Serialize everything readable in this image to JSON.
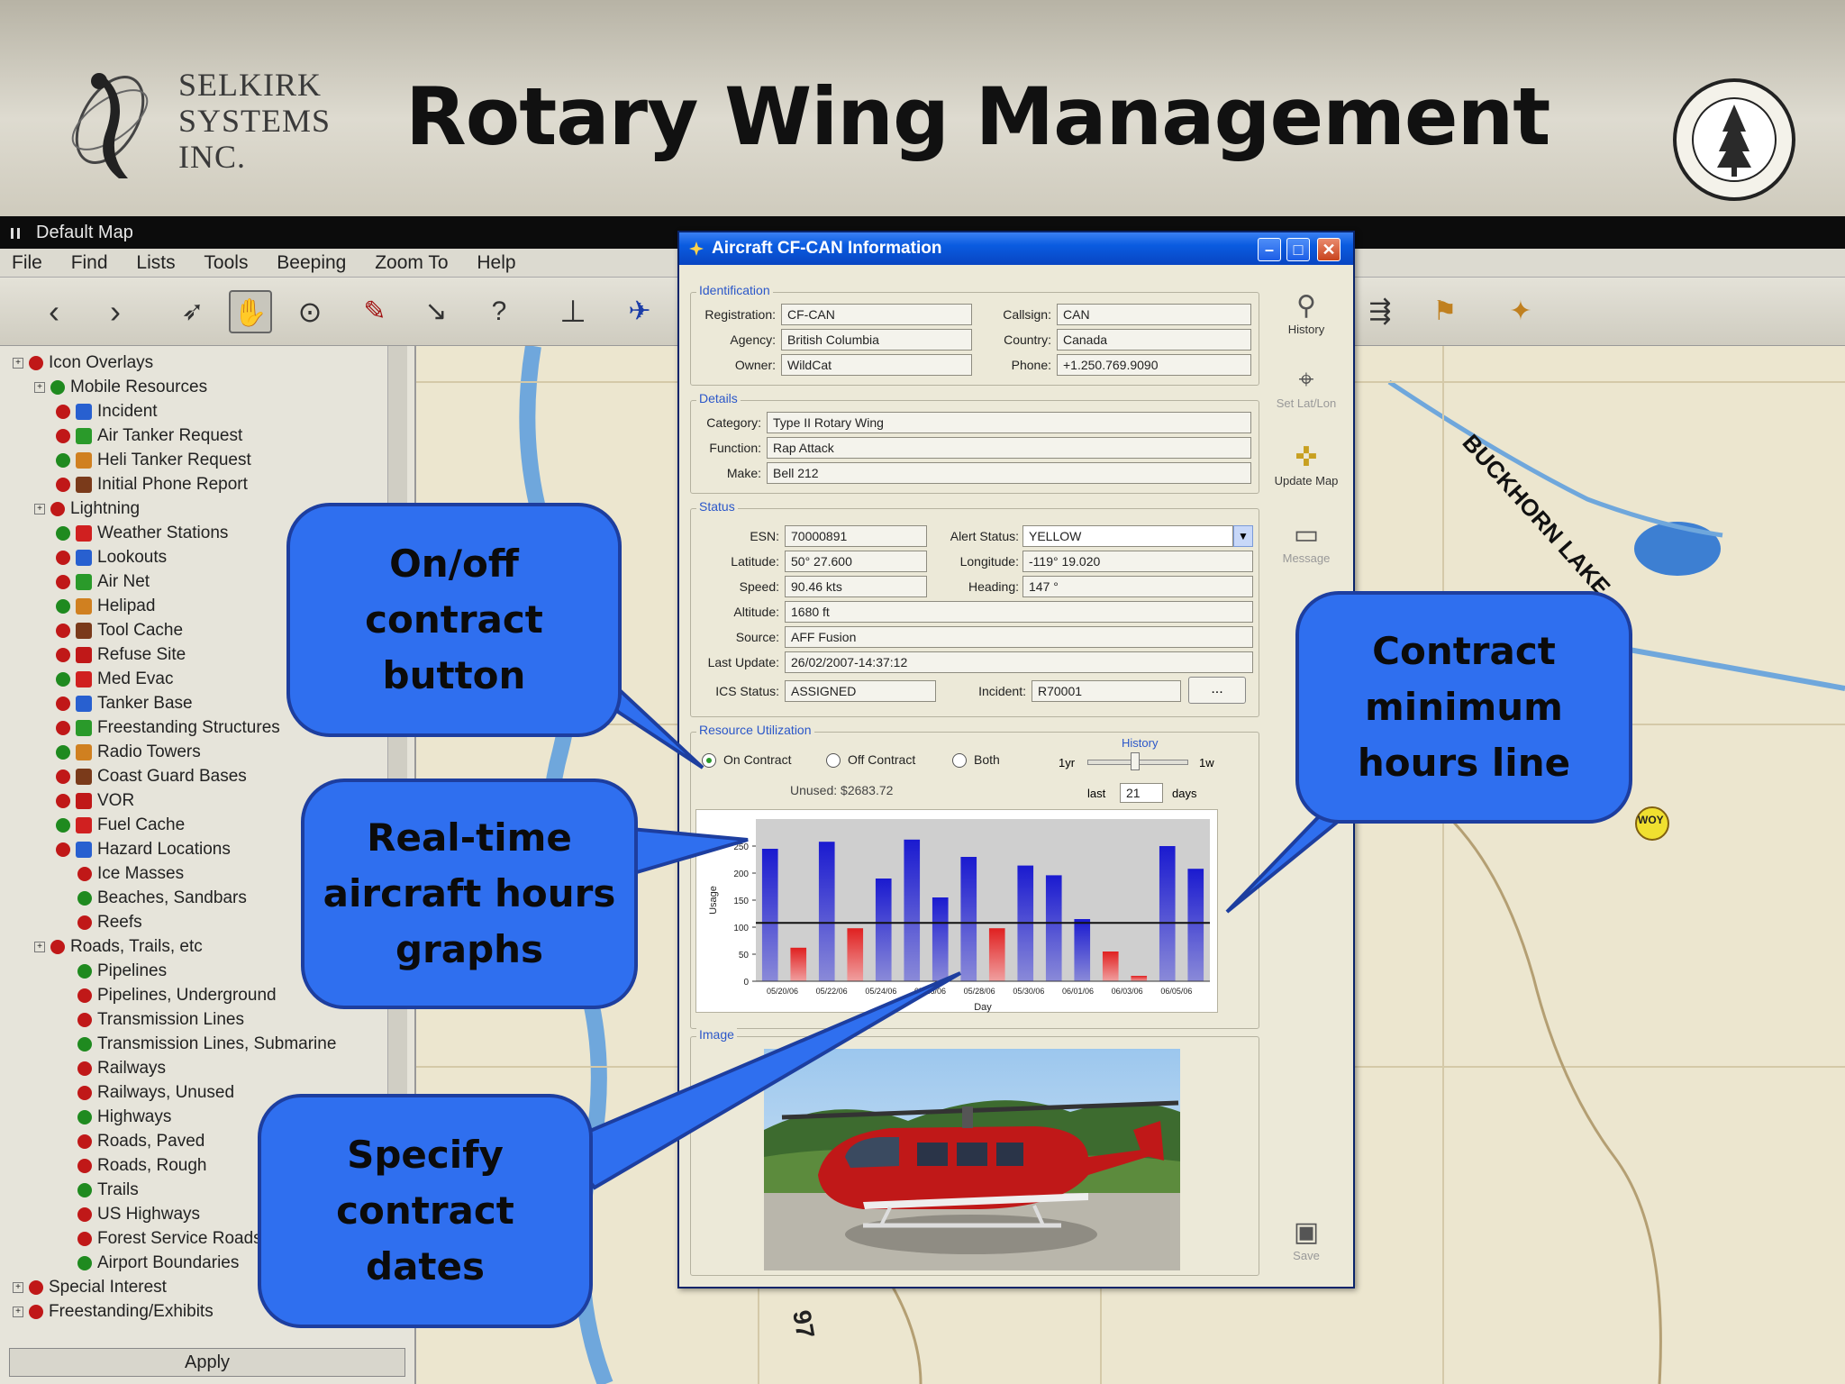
{
  "header": {
    "company_lines": [
      "SELKIRK",
      "SYSTEMS",
      "INC."
    ],
    "title": "Rotary Wing Management"
  },
  "app": {
    "window_title": "Default Map",
    "menu": [
      "File",
      "Find",
      "Lists",
      "Tools",
      "Beeping",
      "Zoom To",
      "Help"
    ]
  },
  "tree": {
    "items": [
      {
        "label": "Icon Overlays",
        "indent": 0
      },
      {
        "label": "Mobile Resources",
        "indent": 1
      },
      {
        "label": "Incident",
        "indent": 2
      },
      {
        "label": "Air Tanker Request",
        "indent": 2
      },
      {
        "label": "Heli Tanker Request",
        "indent": 2
      },
      {
        "label": "Initial Phone Report",
        "indent": 2
      },
      {
        "label": "Lightning",
        "indent": 1
      },
      {
        "label": "Weather Stations",
        "indent": 2
      },
      {
        "label": "Lookouts",
        "indent": 2
      },
      {
        "label": "Air Net",
        "indent": 2
      },
      {
        "label": "Helipad",
        "indent": 2
      },
      {
        "label": "Tool Cache",
        "indent": 2
      },
      {
        "label": "Refuse Site",
        "indent": 2
      },
      {
        "label": "Med Evac",
        "indent": 2
      },
      {
        "label": "Tanker Base",
        "indent": 2
      },
      {
        "label": "Freestanding Structures",
        "indent": 2
      },
      {
        "label": "Radio Towers",
        "indent": 2
      },
      {
        "label": "Coast Guard Bases",
        "indent": 2
      },
      {
        "label": "VOR",
        "indent": 2
      },
      {
        "label": "Fuel Cache",
        "indent": 2
      },
      {
        "label": "Hazard Locations",
        "indent": 2
      },
      {
        "label": "Ice Masses",
        "indent": 3
      },
      {
        "label": "Beaches, Sandbars",
        "indent": 3
      },
      {
        "label": "Reefs",
        "indent": 3
      },
      {
        "label": "Roads, Trails, etc",
        "indent": 1
      },
      {
        "label": "Pipelines",
        "indent": 3
      },
      {
        "label": "Pipelines, Underground",
        "indent": 3
      },
      {
        "label": "Transmission Lines",
        "indent": 3
      },
      {
        "label": "Transmission Lines, Submarine",
        "indent": 3
      },
      {
        "label": "Railways",
        "indent": 3
      },
      {
        "label": "Railways, Unused",
        "indent": 3
      },
      {
        "label": "Highways",
        "indent": 3
      },
      {
        "label": "Roads, Paved",
        "indent": 3
      },
      {
        "label": "Roads, Rough",
        "indent": 3
      },
      {
        "label": "Trails",
        "indent": 3
      },
      {
        "label": "US Highways",
        "indent": 3
      },
      {
        "label": "Forest Service Roads",
        "indent": 3
      },
      {
        "label": "Airport Boundaries",
        "indent": 3
      },
      {
        "label": "Special Interest",
        "indent": 0
      },
      {
        "label": "Freestanding/Exhibits",
        "indent": 0
      }
    ],
    "apply_label": "Apply"
  },
  "map": {
    "lake_label": "BUCKHORN LAKE",
    "marker_label": "WOY",
    "road_label": "97"
  },
  "dialog": {
    "title": "Aircraft CF-CAN Information",
    "identification": {
      "legend": "Identification",
      "registration_label": "Registration:",
      "registration": "CF-CAN",
      "agency_label": "Agency:",
      "agency": "British Columbia",
      "owner_label": "Owner:",
      "owner": "WildCat",
      "callsign_label": "Callsign:",
      "callsign": "CAN",
      "country_label": "Country:",
      "country": "Canada",
      "phone_label": "Phone:",
      "phone": "+1.250.769.9090"
    },
    "details": {
      "legend": "Details",
      "category_label": "Category:",
      "category": "Type II Rotary Wing",
      "function_label": "Function:",
      "function": "Rap Attack",
      "make_label": "Make:",
      "make": "Bell 212"
    },
    "status": {
      "legend": "Status",
      "esn_label": "ESN:",
      "esn": "70000891",
      "alert_label": "Alert Status:",
      "alert": "YELLOW",
      "latitude_label": "Latitude:",
      "latitude": "50° 27.600",
      "longitude_label": "Longitude:",
      "longitude": "-119° 19.020",
      "speed_label": "Speed:",
      "speed": "90.46 kts",
      "heading_label": "Heading:",
      "heading": "147 °",
      "altitude_label": "Altitude:",
      "altitude": "1680 ft",
      "source_label": "Source:",
      "source": "AFF Fusion",
      "last_update_label": "Last Update:",
      "last_update": "26/02/2007-14:37:12",
      "ics_label": "ICS Status:",
      "ics": "ASSIGNED",
      "incident_label": "Incident:",
      "incident": "R70001",
      "more_button": "..."
    },
    "utilization": {
      "legend": "Resource Utilization",
      "on_contract": "On Contract",
      "off_contract": "Off Contract",
      "both": "Both",
      "history_label": "History",
      "slider_left": "1yr",
      "slider_right": "1w",
      "unused": "Unused: $2683.72",
      "last_label": "last",
      "last_value": "21",
      "days_label": "days"
    },
    "image_legend": "Image",
    "side_buttons": {
      "history": "History",
      "set_latlon": "Set Lat/Lon",
      "update_map": "Update Map",
      "message": "Message",
      "save": "Save"
    }
  },
  "chart_data": {
    "type": "bar",
    "xlabel": "Day",
    "ylabel": "Usage",
    "ylim": [
      0,
      300
    ],
    "yticks": [
      0,
      50,
      100,
      150,
      200,
      250
    ],
    "ytick_labels": [
      "0",
      "50",
      "100",
      "150",
      "200",
      "250"
    ],
    "x_tick_labels": [
      "05/20/06",
      "05/22/06",
      "05/24/06",
      "05/26/06",
      "05/28/06",
      "05/30/06",
      "06/01/06",
      "06/03/06",
      "06/05/06"
    ],
    "bars": [
      {
        "value": 245,
        "color": "blue"
      },
      {
        "value": 62,
        "color": "red"
      },
      {
        "value": 258,
        "color": "blue"
      },
      {
        "value": 98,
        "color": "red"
      },
      {
        "value": 190,
        "color": "blue"
      },
      {
        "value": 262,
        "color": "blue"
      },
      {
        "value": 155,
        "color": "blue"
      },
      {
        "value": 230,
        "color": "blue"
      },
      {
        "value": 98,
        "color": "red"
      },
      {
        "value": 214,
        "color": "blue"
      },
      {
        "value": 196,
        "color": "blue"
      },
      {
        "value": 115,
        "color": "blue"
      },
      {
        "value": 55,
        "color": "red"
      },
      {
        "value": 10,
        "color": "red"
      },
      {
        "value": 250,
        "color": "blue"
      },
      {
        "value": 208,
        "color": "blue"
      }
    ],
    "minimum_line": 108,
    "colors": {
      "blue": "#1a1ad0",
      "red": "#e02020"
    },
    "grid": false
  },
  "callouts": {
    "onoff": "On/off\ncontract\nbutton",
    "realtime": "Real-time\naircraft hours\ngraphs",
    "dates": "Specify\ncontract\ndates",
    "minline": "Contract\nminimum\nhours line",
    "fill_color": "#2f6fef"
  }
}
